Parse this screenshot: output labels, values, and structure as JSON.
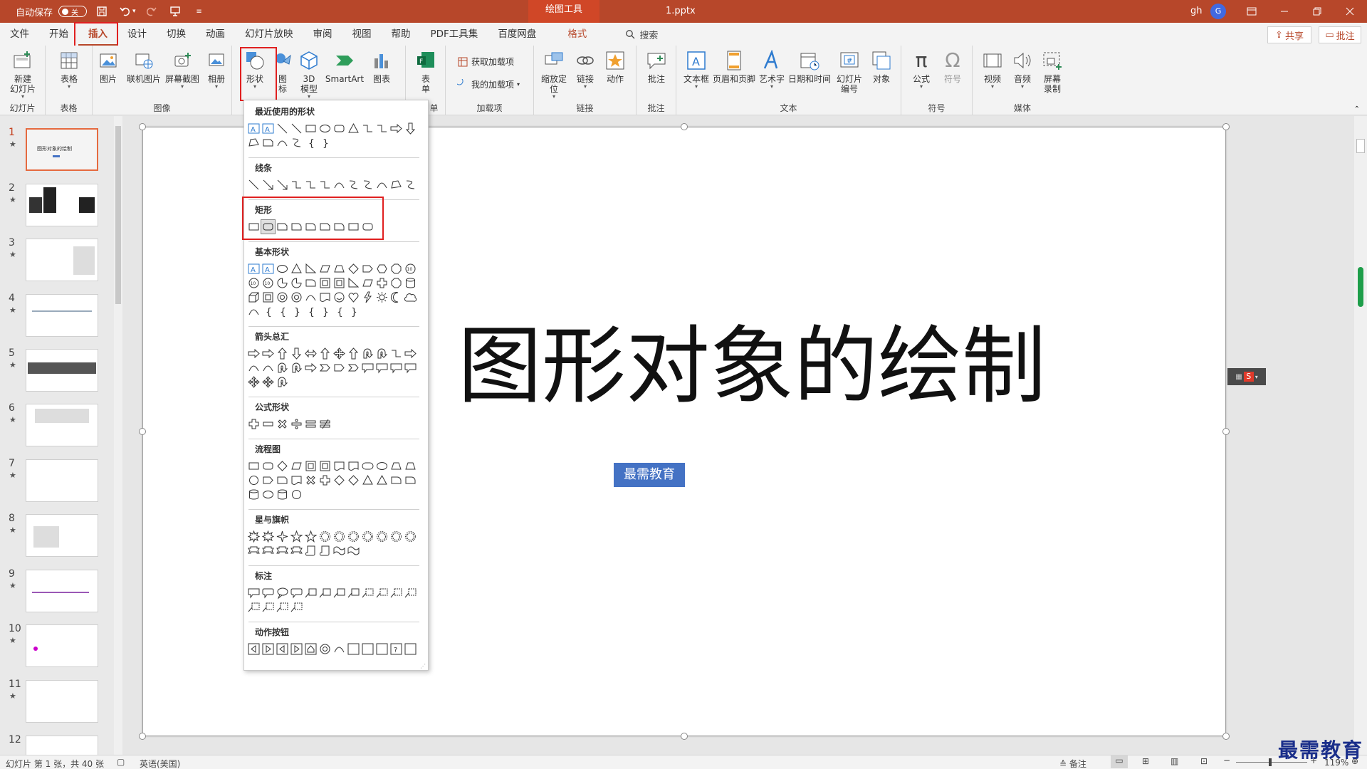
{
  "titlebar": {
    "autosave_label": "自动保存",
    "toggle_state": "关",
    "context_tab": "绘图工具",
    "doc_title": "1.pptx",
    "user_name": "gh",
    "user_initial": "G"
  },
  "tabs": [
    "文件",
    "开始",
    "插入",
    "设计",
    "切换",
    "动画",
    "幻灯片放映",
    "审阅",
    "视图",
    "帮助",
    "PDF工具集",
    "百度网盘",
    "格式"
  ],
  "active_tab": "插入",
  "search_label": "搜索",
  "share_label": "共享",
  "comments_label": "批注",
  "ribbon": {
    "groups": [
      "幻灯片",
      "表格",
      "图像",
      "单",
      "加载项",
      "链接",
      "批注",
      "文本",
      "符号",
      "媒体"
    ],
    "buttons": {
      "new_slide": "新建\n幻灯片",
      "table": "表格",
      "picture": "图片",
      "online_picture": "联机图片",
      "screenshot": "屏幕截图",
      "album": "相册",
      "shapes": "形状",
      "icons": "图\n标",
      "model3d": "3D\n模型",
      "smartart": "SmartArt",
      "chart": "图表",
      "forms": "表\n单",
      "get_addins": "获取加载项",
      "my_addins": "我的加载项",
      "zoom": "缩放定\n位",
      "link": "链接",
      "action": "动作",
      "comment": "批注",
      "textbox": "文本框",
      "header_footer": "页眉和页脚",
      "wordart": "艺术字",
      "datetime": "日期和时间",
      "slide_number": "幻灯片\n编号",
      "object": "对象",
      "equation": "公式",
      "symbol": "符号",
      "video": "视频",
      "audio": "音频",
      "screen_record": "屏幕\n录制"
    }
  },
  "shapes_menu": {
    "sections": [
      "最近使用的形状",
      "线条",
      "矩形",
      "基本形状",
      "箭头总汇",
      "公式形状",
      "流程图",
      "星与旗帜",
      "标注",
      "动作按钮"
    ]
  },
  "thumbnails": {
    "numbers": [
      "1",
      "2",
      "3",
      "4",
      "5",
      "6",
      "7",
      "8",
      "9",
      "10",
      "11",
      "12"
    ],
    "first_title": "图形对象的绘制",
    "star": "★"
  },
  "slide": {
    "title": "图形对象的绘制",
    "subtitle": "最需教育"
  },
  "status": {
    "slide_info": "幻灯片 第 1 张，共 40 张",
    "language": "英语(美国)",
    "notes": "备注",
    "zoom": "119%"
  },
  "watermark": "最需教育",
  "colors": {
    "brand": "#b7472a",
    "accent_blue": "#4472c4",
    "highlight_box": "#e02020"
  }
}
